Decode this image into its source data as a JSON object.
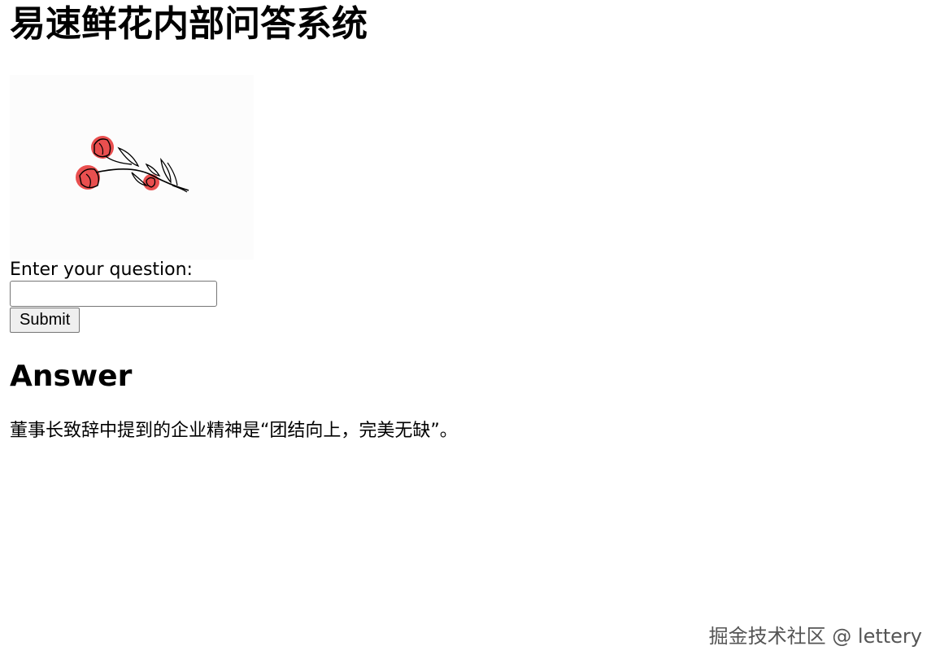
{
  "title": "易速鲜花内部问答系统",
  "logo": {
    "icon": "flower-branch-illustration"
  },
  "form": {
    "question_label": "Enter your question:",
    "question_value": "",
    "submit_label": "Submit"
  },
  "answer": {
    "heading": "Answer",
    "text": "董事长致辞中提到的企业精神是“团结向上，完美无缺”。"
  },
  "watermark": "掘金技术社区 @ lettery",
  "colors": {
    "accent": "#e94f4f"
  }
}
